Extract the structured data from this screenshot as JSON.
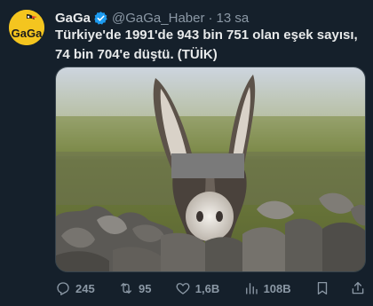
{
  "author": {
    "name": "GaGa",
    "handle": "@GaGa_Haber",
    "separator": "·",
    "time": "13 sa",
    "avatar_text": "GaGa"
  },
  "tweet": {
    "line1": "Türkiye'de 1991'de 943 bin 751 olan eşek sayısı,",
    "line2": "74 bin 704'e düştü. (TÜİK)"
  },
  "media": {
    "subject": "donkey-photo"
  },
  "actions": {
    "replies": "245",
    "retweets": "95",
    "likes": "1,6B",
    "views": "108B"
  },
  "colors": {
    "background": "#15202b",
    "text": "#e7e9ea",
    "muted": "#8b98a5",
    "verified": "#1d9bf0",
    "avatar": "#f4c51f"
  },
  "icons": [
    "reply-icon",
    "retweet-icon",
    "like-icon",
    "views-icon",
    "bookmark-icon",
    "share-icon",
    "verified-badge-icon"
  ]
}
